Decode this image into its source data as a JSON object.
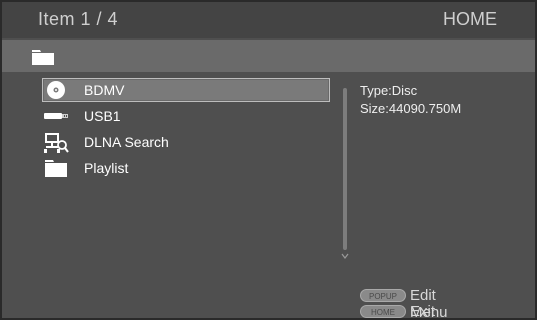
{
  "header": {
    "item_count": "Item 1 / 4",
    "home_label": "HOME"
  },
  "pathbar": {
    "icon": "folder-icon"
  },
  "list": {
    "items": [
      {
        "label": "BDMV",
        "icon": "disc-icon",
        "selected": true
      },
      {
        "label": "USB1",
        "icon": "usb-icon",
        "selected": false
      },
      {
        "label": "DLNA Search",
        "icon": "dlna-search-icon",
        "selected": false
      },
      {
        "label": "Playlist",
        "icon": "folder-icon",
        "selected": false
      }
    ]
  },
  "info": {
    "type": "Type:Disc",
    "size": "Size:44090.750M"
  },
  "footer": {
    "popup_key": "POPUP",
    "popup_action": "Edit Menu",
    "home_key": "HOME",
    "home_action": "Exit"
  }
}
